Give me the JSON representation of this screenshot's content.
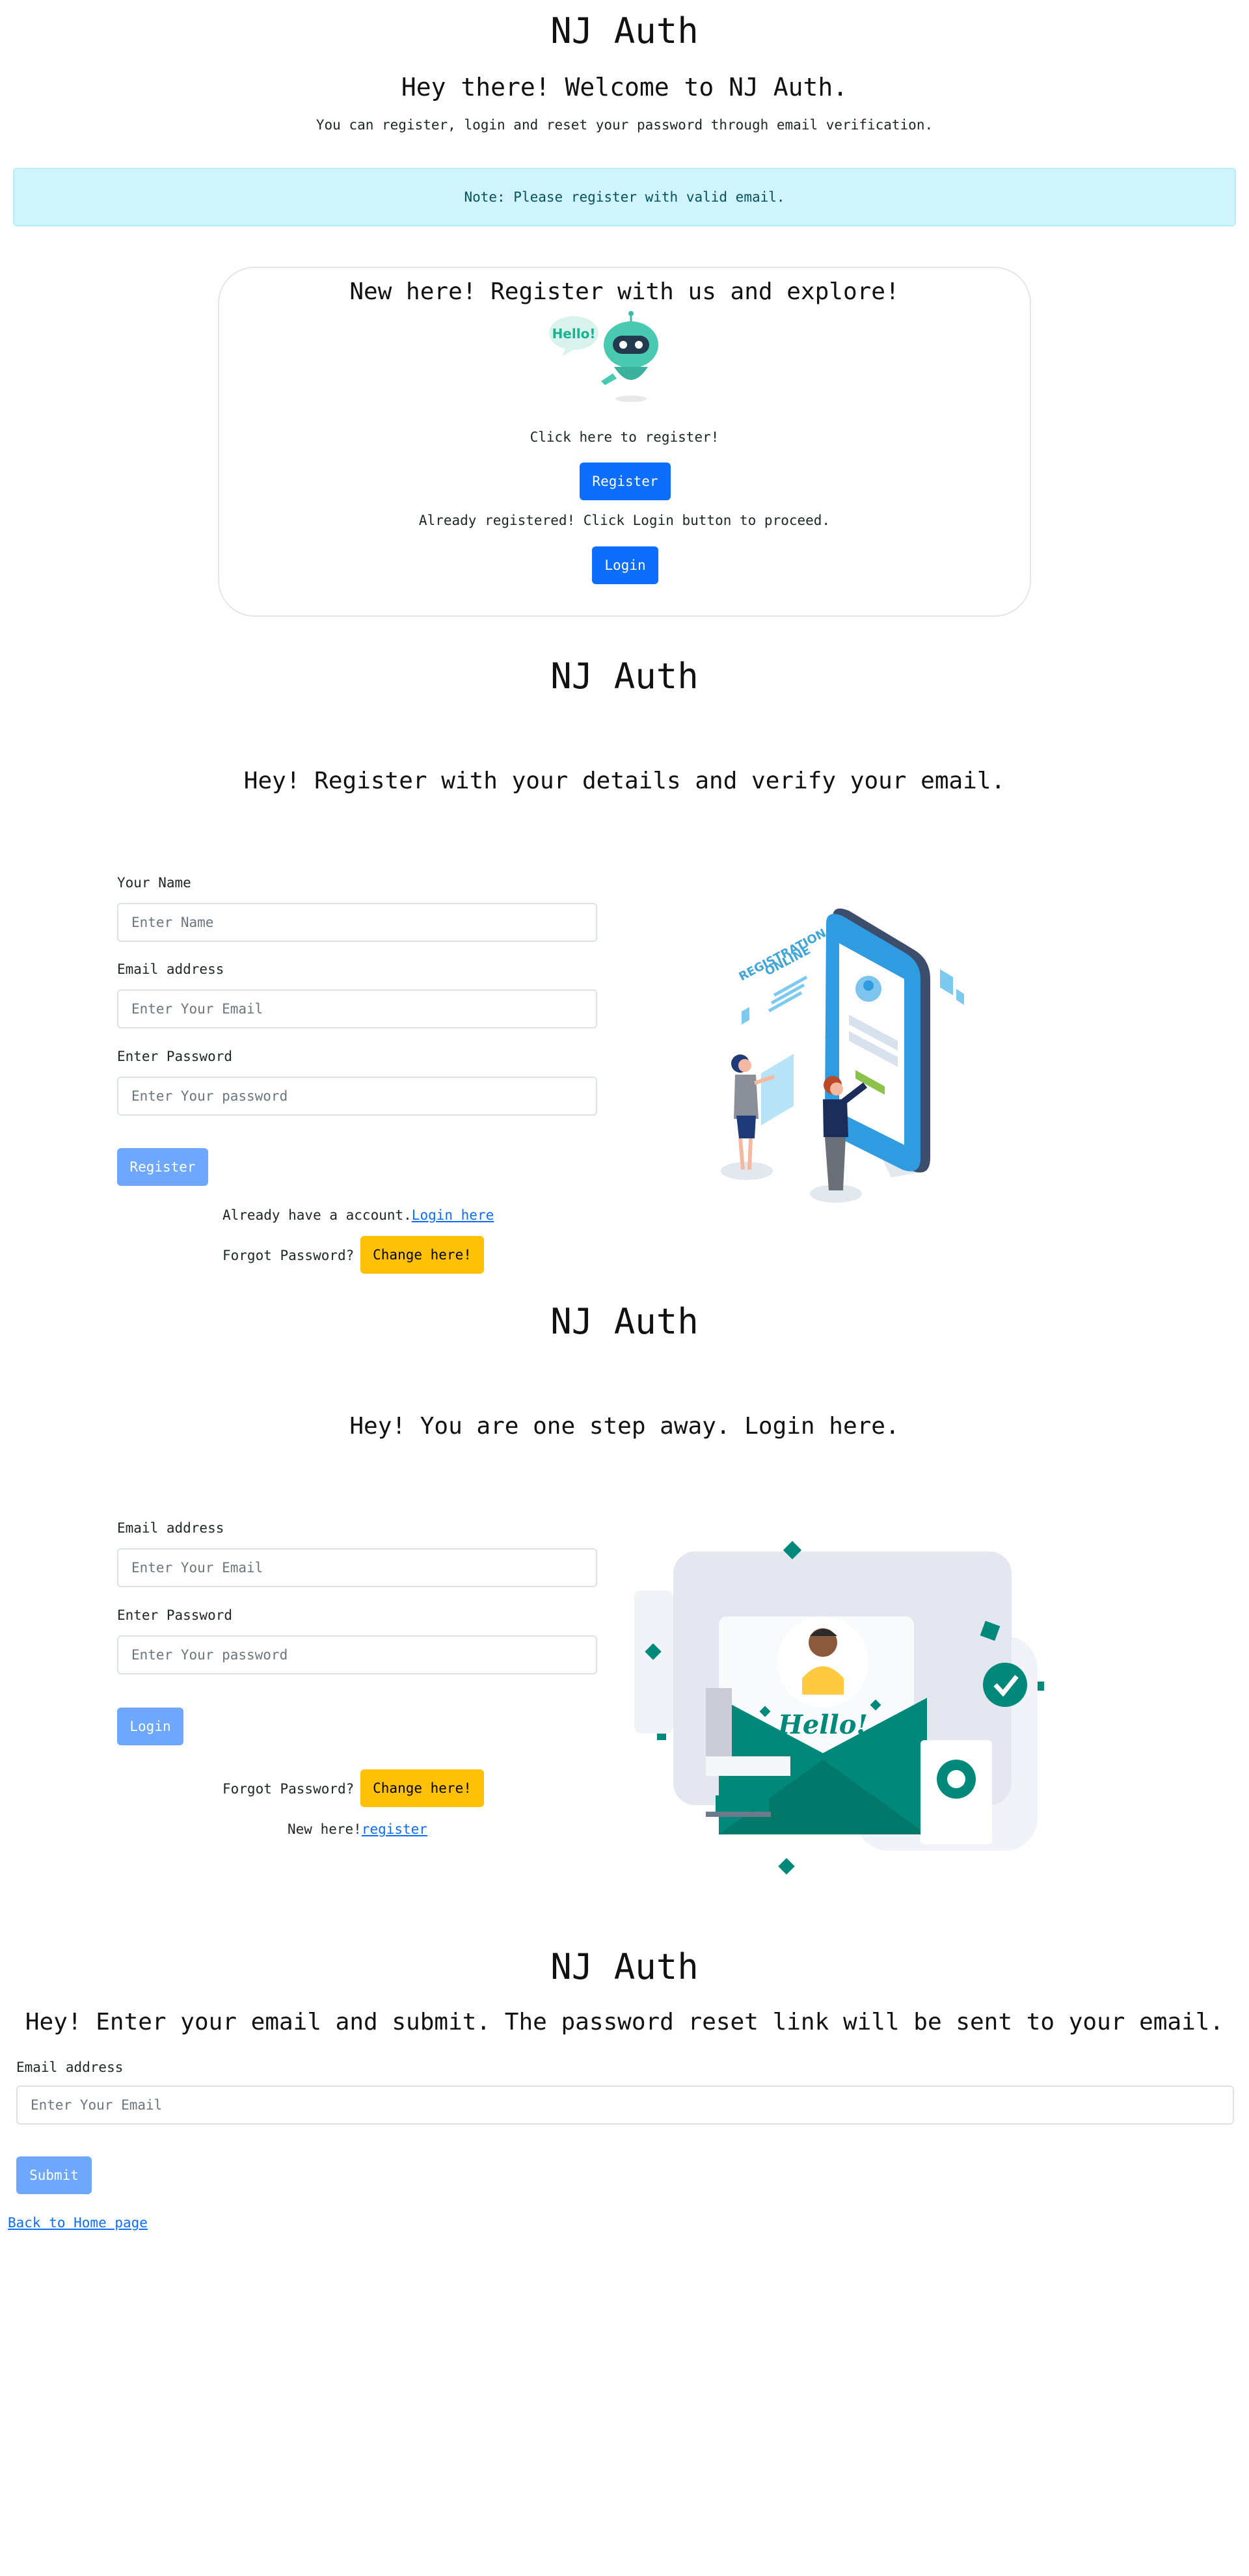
{
  "home": {
    "title": "NJ Auth",
    "welcome": "Hey there! Welcome to NJ Auth.",
    "subtitle": "You can register, login and reset your password through email verification.",
    "alert": "Note: Please register with valid email.",
    "card": {
      "heading": "New here! Register with us and explore!",
      "bubble_text": "Hello!",
      "register_prompt": "Click here to register!",
      "register_button": "Register",
      "login_prompt": "Already registered! Click Login button to proceed.",
      "login_button": "Login"
    }
  },
  "register": {
    "title": "NJ Auth",
    "heading": "Hey! Register with your details and verify your email.",
    "name_label": "Your Name",
    "name_placeholder": "Enter Name",
    "email_label": "Email address",
    "email_placeholder": "Enter Your Email",
    "password_label": "Enter Password",
    "password_placeholder": "Enter Your password",
    "submit_button": "Register",
    "have_account_text": "Already have a account.",
    "login_link": "Login here",
    "forgot_text": "Forgot Password?",
    "change_button": "Change here!",
    "illustration_text_1": "ONLINE",
    "illustration_text_2": "REGISTRATION"
  },
  "login": {
    "title": "NJ Auth",
    "heading": "Hey! You are one step away. Login here.",
    "email_label": "Email address",
    "email_placeholder": "Enter Your Email",
    "password_label": "Enter Password",
    "password_placeholder": "Enter Your password",
    "submit_button": "Login",
    "forgot_text": "Forgot Password?",
    "change_button": "Change here!",
    "new_here_text": "New here!",
    "register_link": "register",
    "illustration_text": "Hello!"
  },
  "reset": {
    "title": "NJ Auth",
    "heading": "Hey! Enter your email and submit. The password reset link will be sent to your email.",
    "email_label": "Email address",
    "email_placeholder": "Enter Your Email",
    "submit_button": "Submit",
    "back_link": "Back to Home page"
  },
  "colors": {
    "primary": "#0d6efd",
    "primary_disabled": "#6ea8fe",
    "warning": "#ffc107",
    "alert_bg": "#cff4fc",
    "teal": "#00897b"
  }
}
